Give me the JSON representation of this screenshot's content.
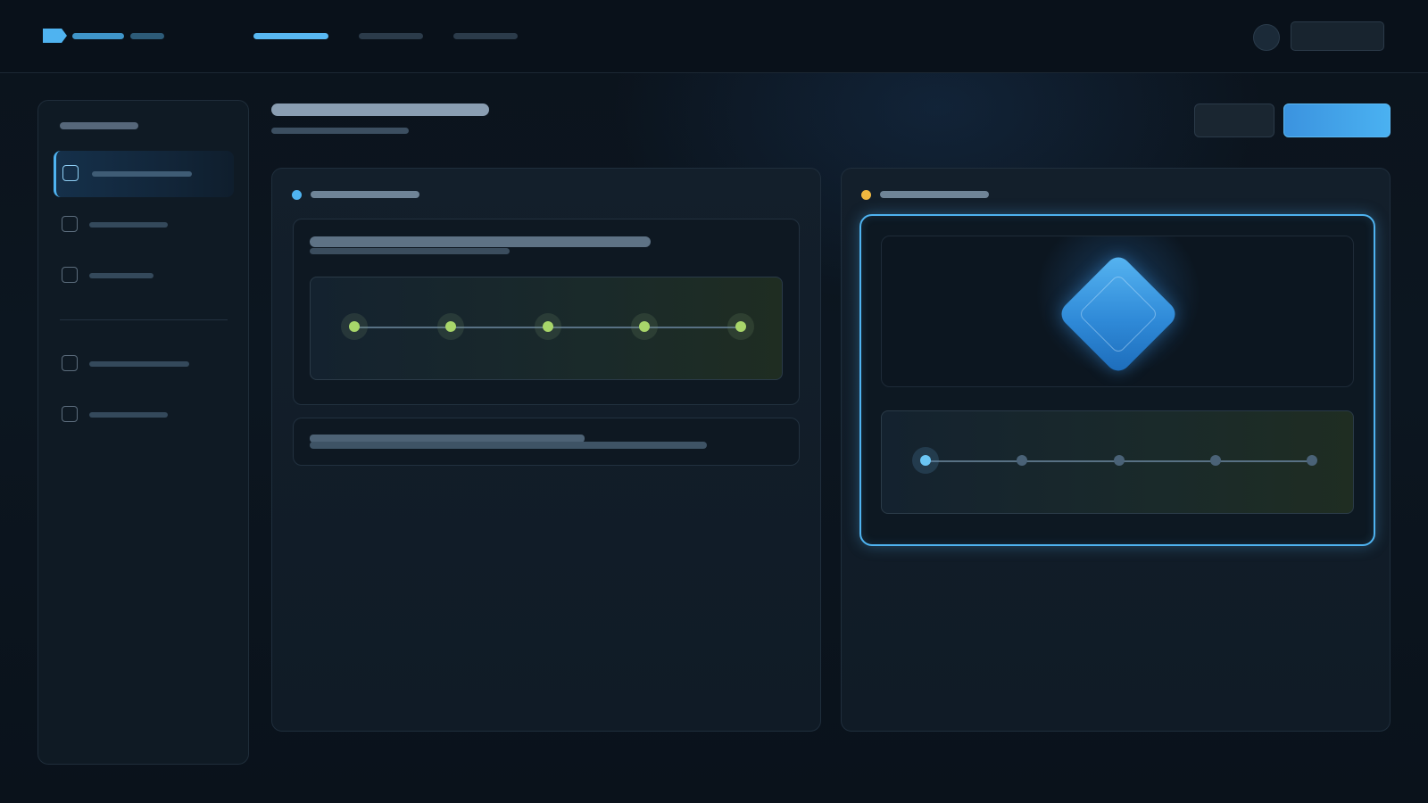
{
  "theme": {
    "accent": "#4fb3f0",
    "primary_button": "#3b93df",
    "panel_left_dot": "#4fb3f0",
    "panel_right_dot": "#f0b840",
    "step_done": "#a8d66a",
    "step_current": "#6bc6f5",
    "step_pending": "#4a6277"
  },
  "icons": {
    "logo": "logo-mark",
    "user": "avatar-circle",
    "sidebar_item": "checkbox-square",
    "preview": "diamond"
  },
  "panels": {
    "left": {
      "progress": {
        "total_steps": 5,
        "completed_steps": 5
      }
    },
    "right": {
      "progress": {
        "total_steps": 5,
        "completed_steps": 0,
        "current_step": 1
      }
    }
  }
}
